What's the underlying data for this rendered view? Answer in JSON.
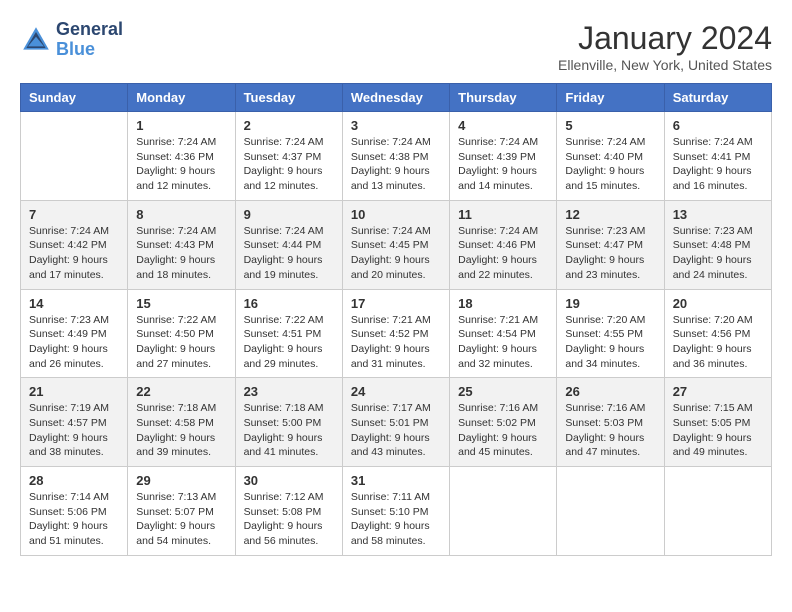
{
  "header": {
    "logo_line1": "General",
    "logo_line2": "Blue",
    "month_title": "January 2024",
    "location": "Ellenville, New York, United States"
  },
  "days_of_week": [
    "Sunday",
    "Monday",
    "Tuesday",
    "Wednesday",
    "Thursday",
    "Friday",
    "Saturday"
  ],
  "weeks": [
    [
      {
        "day": "",
        "info": ""
      },
      {
        "day": "1",
        "info": "Sunrise: 7:24 AM\nSunset: 4:36 PM\nDaylight: 9 hours\nand 12 minutes."
      },
      {
        "day": "2",
        "info": "Sunrise: 7:24 AM\nSunset: 4:37 PM\nDaylight: 9 hours\nand 12 minutes."
      },
      {
        "day": "3",
        "info": "Sunrise: 7:24 AM\nSunset: 4:38 PM\nDaylight: 9 hours\nand 13 minutes."
      },
      {
        "day": "4",
        "info": "Sunrise: 7:24 AM\nSunset: 4:39 PM\nDaylight: 9 hours\nand 14 minutes."
      },
      {
        "day": "5",
        "info": "Sunrise: 7:24 AM\nSunset: 4:40 PM\nDaylight: 9 hours\nand 15 minutes."
      },
      {
        "day": "6",
        "info": "Sunrise: 7:24 AM\nSunset: 4:41 PM\nDaylight: 9 hours\nand 16 minutes."
      }
    ],
    [
      {
        "day": "7",
        "info": "Sunrise: 7:24 AM\nSunset: 4:42 PM\nDaylight: 9 hours\nand 17 minutes."
      },
      {
        "day": "8",
        "info": "Sunrise: 7:24 AM\nSunset: 4:43 PM\nDaylight: 9 hours\nand 18 minutes."
      },
      {
        "day": "9",
        "info": "Sunrise: 7:24 AM\nSunset: 4:44 PM\nDaylight: 9 hours\nand 19 minutes."
      },
      {
        "day": "10",
        "info": "Sunrise: 7:24 AM\nSunset: 4:45 PM\nDaylight: 9 hours\nand 20 minutes."
      },
      {
        "day": "11",
        "info": "Sunrise: 7:24 AM\nSunset: 4:46 PM\nDaylight: 9 hours\nand 22 minutes."
      },
      {
        "day": "12",
        "info": "Sunrise: 7:23 AM\nSunset: 4:47 PM\nDaylight: 9 hours\nand 23 minutes."
      },
      {
        "day": "13",
        "info": "Sunrise: 7:23 AM\nSunset: 4:48 PM\nDaylight: 9 hours\nand 24 minutes."
      }
    ],
    [
      {
        "day": "14",
        "info": "Sunrise: 7:23 AM\nSunset: 4:49 PM\nDaylight: 9 hours\nand 26 minutes."
      },
      {
        "day": "15",
        "info": "Sunrise: 7:22 AM\nSunset: 4:50 PM\nDaylight: 9 hours\nand 27 minutes."
      },
      {
        "day": "16",
        "info": "Sunrise: 7:22 AM\nSunset: 4:51 PM\nDaylight: 9 hours\nand 29 minutes."
      },
      {
        "day": "17",
        "info": "Sunrise: 7:21 AM\nSunset: 4:52 PM\nDaylight: 9 hours\nand 31 minutes."
      },
      {
        "day": "18",
        "info": "Sunrise: 7:21 AM\nSunset: 4:54 PM\nDaylight: 9 hours\nand 32 minutes."
      },
      {
        "day": "19",
        "info": "Sunrise: 7:20 AM\nSunset: 4:55 PM\nDaylight: 9 hours\nand 34 minutes."
      },
      {
        "day": "20",
        "info": "Sunrise: 7:20 AM\nSunset: 4:56 PM\nDaylight: 9 hours\nand 36 minutes."
      }
    ],
    [
      {
        "day": "21",
        "info": "Sunrise: 7:19 AM\nSunset: 4:57 PM\nDaylight: 9 hours\nand 38 minutes."
      },
      {
        "day": "22",
        "info": "Sunrise: 7:18 AM\nSunset: 4:58 PM\nDaylight: 9 hours\nand 39 minutes."
      },
      {
        "day": "23",
        "info": "Sunrise: 7:18 AM\nSunset: 5:00 PM\nDaylight: 9 hours\nand 41 minutes."
      },
      {
        "day": "24",
        "info": "Sunrise: 7:17 AM\nSunset: 5:01 PM\nDaylight: 9 hours\nand 43 minutes."
      },
      {
        "day": "25",
        "info": "Sunrise: 7:16 AM\nSunset: 5:02 PM\nDaylight: 9 hours\nand 45 minutes."
      },
      {
        "day": "26",
        "info": "Sunrise: 7:16 AM\nSunset: 5:03 PM\nDaylight: 9 hours\nand 47 minutes."
      },
      {
        "day": "27",
        "info": "Sunrise: 7:15 AM\nSunset: 5:05 PM\nDaylight: 9 hours\nand 49 minutes."
      }
    ],
    [
      {
        "day": "28",
        "info": "Sunrise: 7:14 AM\nSunset: 5:06 PM\nDaylight: 9 hours\nand 51 minutes."
      },
      {
        "day": "29",
        "info": "Sunrise: 7:13 AM\nSunset: 5:07 PM\nDaylight: 9 hours\nand 54 minutes."
      },
      {
        "day": "30",
        "info": "Sunrise: 7:12 AM\nSunset: 5:08 PM\nDaylight: 9 hours\nand 56 minutes."
      },
      {
        "day": "31",
        "info": "Sunrise: 7:11 AM\nSunset: 5:10 PM\nDaylight: 9 hours\nand 58 minutes."
      },
      {
        "day": "",
        "info": ""
      },
      {
        "day": "",
        "info": ""
      },
      {
        "day": "",
        "info": ""
      }
    ]
  ]
}
